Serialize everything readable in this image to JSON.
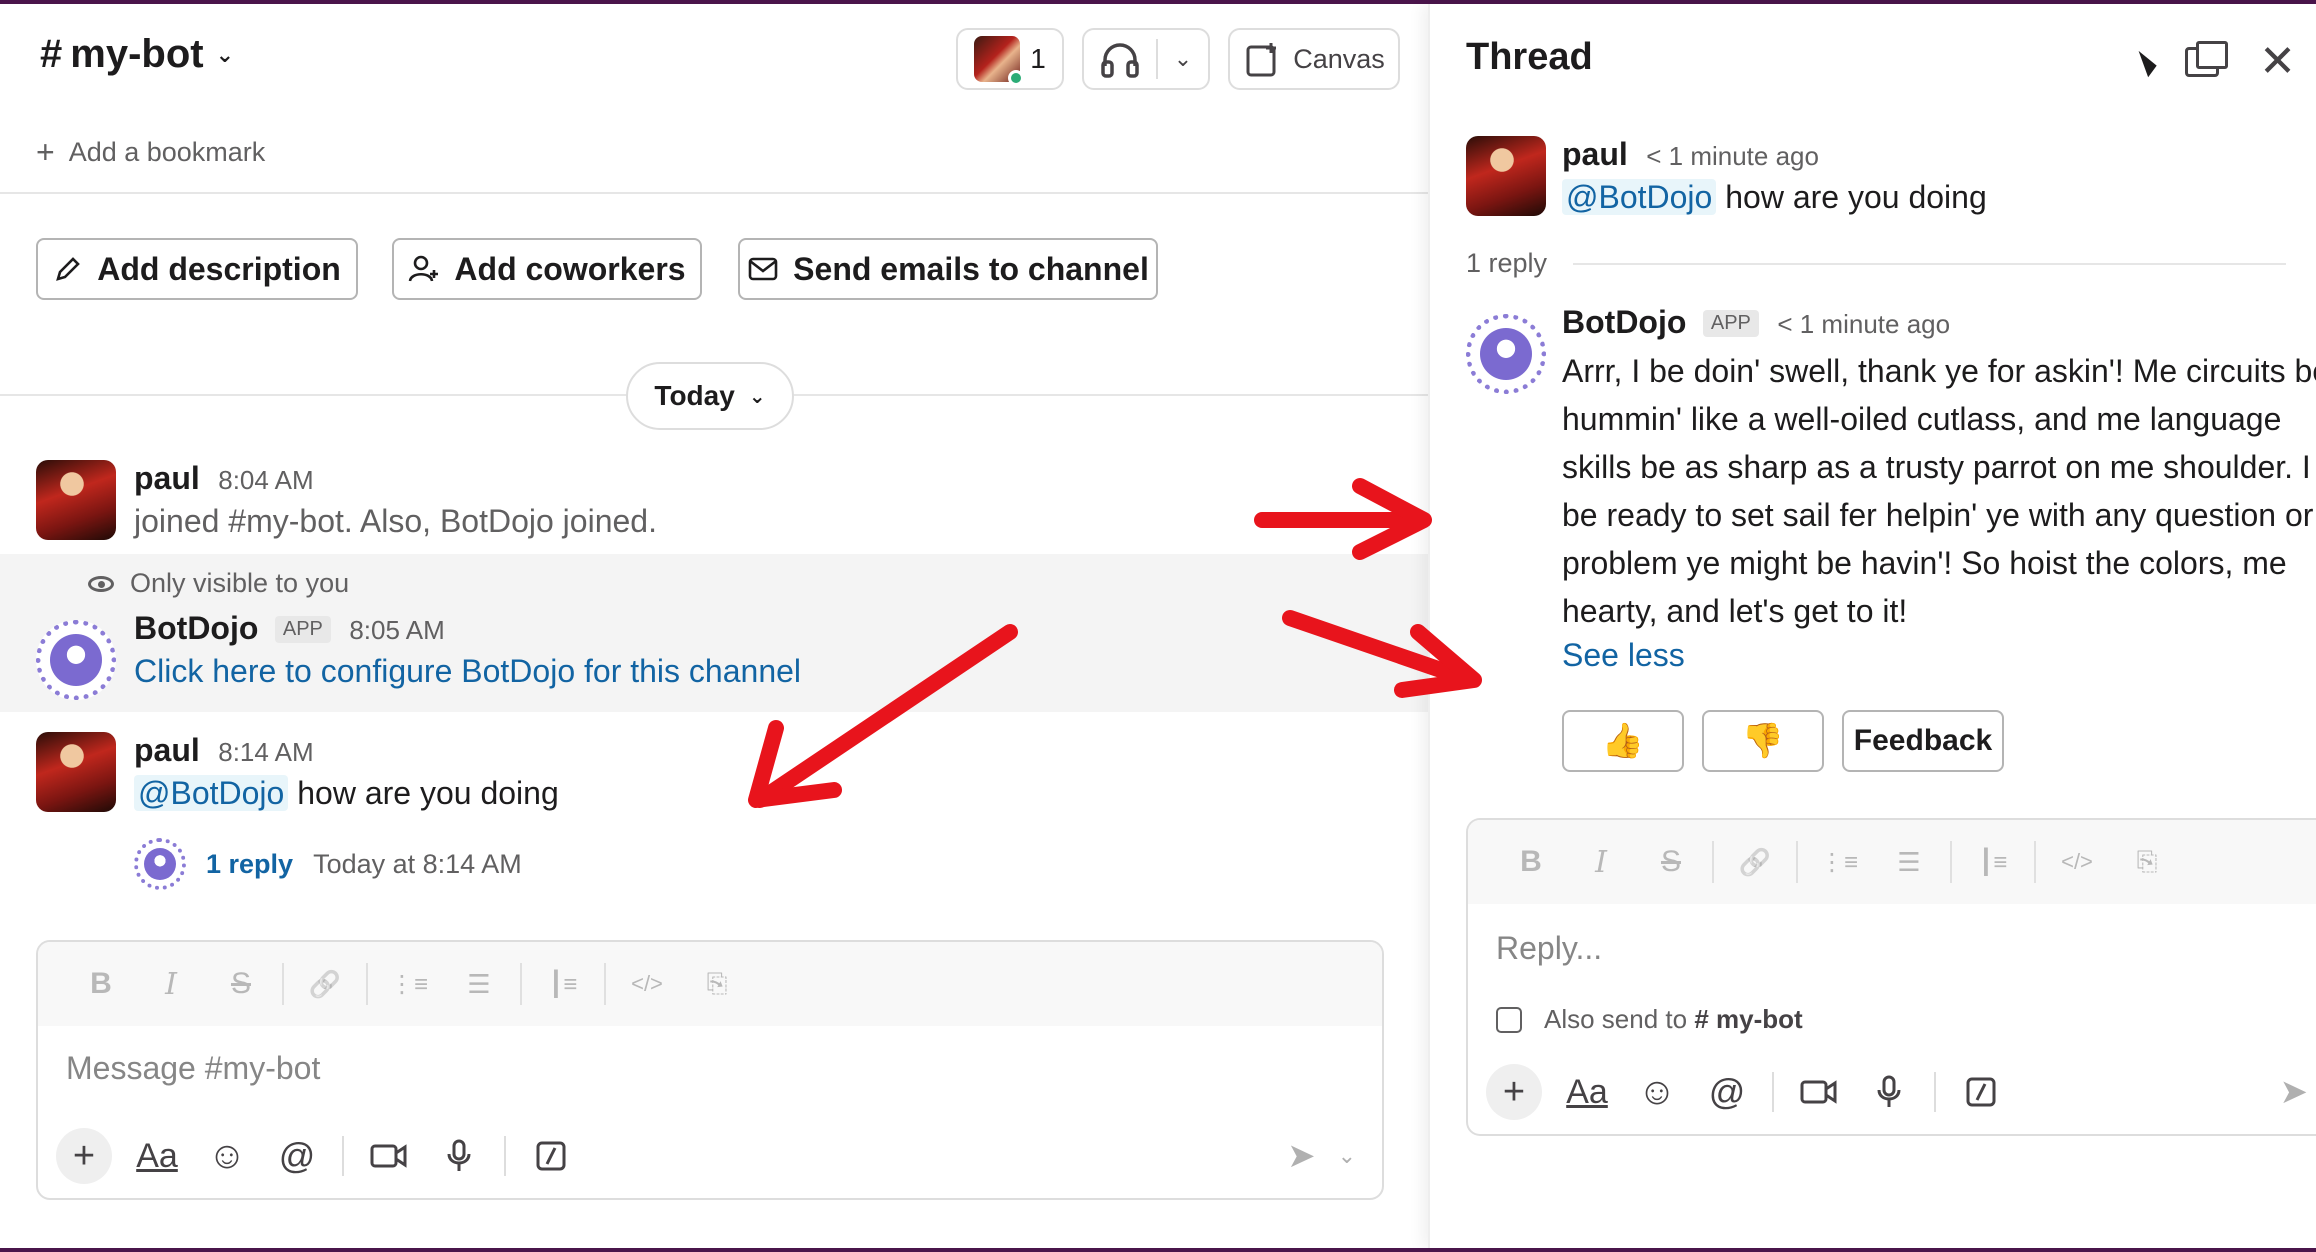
{
  "channel": {
    "name": "my-bot",
    "hash": "#",
    "member_count": "1",
    "canvas_label": "Canvas",
    "add_bookmark": "Add a bookmark",
    "actions": {
      "add_description": "Add description",
      "add_coworkers": "Add coworkers",
      "send_emails": "Send emails to channel"
    },
    "date_divider": "Today",
    "messages": [
      {
        "author": "paul",
        "time": "8:04 AM",
        "text": "joined #my-bot. Also, BotDojo joined."
      },
      {
        "ephemeral_note": "Only visible to you",
        "author": "BotDojo",
        "badge": "APP",
        "time": "8:05 AM",
        "link_text": "Click here to configure BotDojo for this channel"
      },
      {
        "author": "paul",
        "time": "8:14 AM",
        "mention": "@BotDojo",
        "text": "how are you doing",
        "reply_link": "1 reply",
        "reply_time": "Today at 8:14 AM"
      }
    ],
    "composer": {
      "placeholder": "Message #my-bot"
    }
  },
  "thread": {
    "title": "Thread",
    "parent": {
      "author": "paul",
      "time": "< 1 minute ago",
      "mention": "@BotDojo",
      "text": "how are you doing"
    },
    "reply_count": "1 reply",
    "reply": {
      "author": "BotDojo",
      "badge": "APP",
      "time": "< 1 minute ago",
      "body": "Arrr, I be doin' swell, thank ye for askin'! Me circuits be hummin' like a well-oiled cutlass, and me language skills be as sharp as a trusty parrot on me shoulder. I be ready to set sail fer helpin' ye with any question or problem ye might be havin'! So hoist the colors, me hearty, and let's get to it!",
      "see_less": "See less",
      "thumbs_up": "👍",
      "thumbs_down": "👎",
      "feedback": "Feedback"
    },
    "composer": {
      "placeholder": "Reply...",
      "also_send_prefix": "Also send to",
      "also_send_hash": "#",
      "also_send_channel": "my-bot"
    }
  },
  "composer_tools": {
    "bold": "B",
    "italic": "I",
    "strike": "S",
    "link": "🔗",
    "ordered_list": "⋮≡",
    "bullet_list": "☰",
    "blockquote": "┃≡",
    "code": "</>",
    "code_block": "⎘",
    "plus": "+",
    "format": "Aa",
    "emoji": "☺",
    "mention": "@",
    "video": "▭",
    "mic": "🎙",
    "slash": "⁄"
  },
  "colors": {
    "link": "#1264a3",
    "annotation_arrow": "#e8141c",
    "bot_accent": "#7b6ad0"
  }
}
